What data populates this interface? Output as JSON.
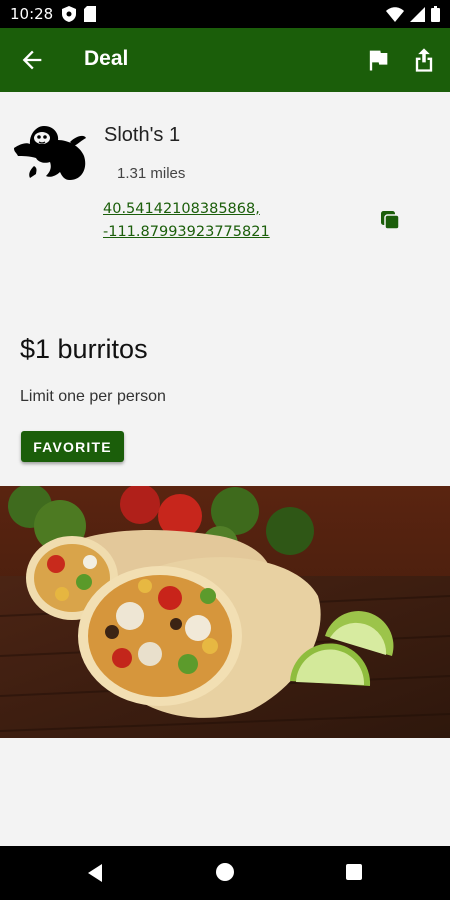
{
  "status_bar": {
    "time": "10:28"
  },
  "app_bar": {
    "title": "Deal",
    "icons": [
      "back-arrow-icon",
      "flag-icon",
      "share-icon"
    ]
  },
  "location": {
    "name": "Sloth's 1",
    "distance": "1.31 miles",
    "latitude": "40.54142108385868,",
    "longitude": "-111.87993923775821"
  },
  "deal": {
    "title": "$1 burritos",
    "description": "Limit one per person",
    "favorite_label": "FAVORITE"
  },
  "colors": {
    "primary": "#1b5e0a",
    "background": "#f3f3f3"
  }
}
